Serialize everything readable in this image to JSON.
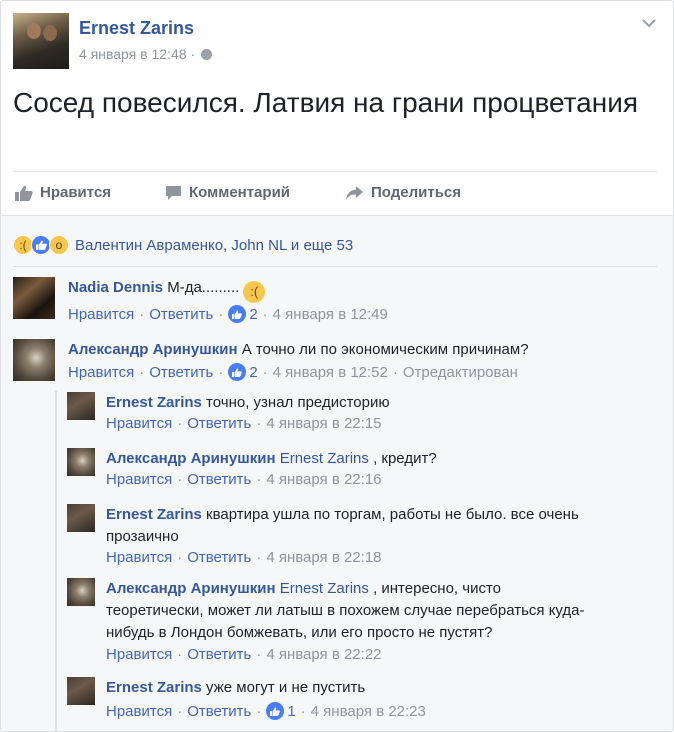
{
  "post": {
    "author": "Ernest Zarins",
    "date": "4 января в 12:48",
    "text": "Сосед повесился. Латвия на грани процветания",
    "privacy_icon": "globe-icon"
  },
  "actions": {
    "like": "Нравится",
    "comment": "Комментарий",
    "share": "Поделиться"
  },
  "reactions": {
    "summary": "Валентин Авраменко, John NL и еще 53",
    "icons": [
      "sad-icon",
      "like-icon",
      "wow-icon"
    ]
  },
  "comments": [
    {
      "author": "Nadia Dennis",
      "text": "М-да.........",
      "emoji": "sad-emoji",
      "like": "Нравится",
      "reply": "Ответить",
      "likes": "2",
      "date": "4 января в 12:49"
    },
    {
      "author": "Александр Аринушкин",
      "text": "А точно ли по экономическим причинам?",
      "like": "Нравится",
      "reply": "Ответить",
      "likes": "2",
      "date": "4 января в 12:52",
      "edited": "Отредактирован"
    }
  ],
  "replies": [
    {
      "author": "Ernest Zarins",
      "text": "точно, узнал предисторию",
      "like": "Нравится",
      "reply": "Ответить",
      "date": "4 января в 22:15"
    },
    {
      "author": "Александр Аринушкин",
      "tag": "Ernest Zarins",
      "text": ", кредит?",
      "like": "Нравится",
      "reply": "Ответить",
      "date": "4 января в 22:16"
    },
    {
      "author": "Ernest Zarins",
      "text": "квартира ушла по торгам, работы не было. все очень прозаично",
      "like": "Нравится",
      "reply": "Ответить",
      "date": "4 января в 22:18"
    },
    {
      "author": "Александр Аринушкин",
      "tag": "Ernest Zarins",
      "text": ", интересно, чисто теоретически, может ли латыш в похожем случае перебраться куда-нибудь в Лондон бомжевать, или его просто не пустят?",
      "like": "Нравится",
      "reply": "Ответить",
      "date": "4 января в 22:22"
    },
    {
      "author": "Ernest Zarins",
      "text": "уже могут и не пустить",
      "like": "Нравится",
      "reply": "Ответить",
      "likes": "1",
      "date": "4 января в 22:23"
    }
  ],
  "colors": {
    "link": "#365899",
    "meta": "#90949c",
    "like_blue": "#4a7df0",
    "comment_bg": "#f6f7f9"
  }
}
